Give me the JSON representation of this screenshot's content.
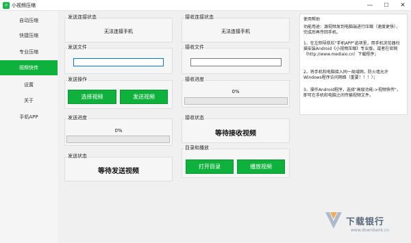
{
  "window": {
    "title": "小视频压缩",
    "icon_text": "小"
  },
  "sidebar": {
    "items": [
      {
        "label": "自动压缩",
        "active": false
      },
      {
        "label": "快捷压缩",
        "active": false
      },
      {
        "label": "专业压缩",
        "active": false
      },
      {
        "label": "视频快传",
        "active": true
      },
      {
        "label": "设置",
        "active": false
      },
      {
        "label": "关于",
        "active": false
      },
      {
        "label": "手机APP",
        "active": false
      }
    ]
  },
  "send": {
    "conn_label": "发送连接状态",
    "conn_status": "无法连接手机",
    "file_label": "发送文件",
    "file_value": "",
    "ops_label": "发送操作",
    "select_button": "选择视频",
    "send_button": "发送视频",
    "progress_label": "发送进度",
    "progress_text": "0%",
    "progress_value": 0,
    "status_label": "发送状态",
    "status_text": "等待发送视频"
  },
  "receive": {
    "conn_label": "接收连接状态",
    "conn_status": "无法连接手机",
    "file_label": "接收文件",
    "file_value": "",
    "progress_label": "接收进度",
    "progress_text": "0%",
    "progress_value": 0,
    "status_label": "接收状态",
    "status_text": "等待接收视频",
    "dir_label": "目录和播放",
    "open_dir_button": "打开目录",
    "play_button": "播放视频"
  },
  "help": {
    "title": "使用帮助",
    "p1": "功能用途：源视频发到电脑端进行压缩（速度更快），完成后再传回手机。",
    "p2": "1、在左侧导航栏\"手机APP\"选项里，用手机浏览器扫描安装Android《小视频压缩》专业版，或者在官网（http://www.mediaio.cn）下载程序；",
    "p3": "2、将手机和电脑接入同一局域网，防火墙允许Windows程序访问网络（重要！！！）；",
    "p4": "3、操作Android程序，选择\"高级功能->视频快传\"，即可在手机和电脑之间传输视频文件。"
  },
  "watermark": {
    "title": "下载银行",
    "url": "www.downbank.cn"
  },
  "colors": {
    "accent": "#0fb13d",
    "titlebar": "#ffffff",
    "background": "#f0f0f0"
  }
}
